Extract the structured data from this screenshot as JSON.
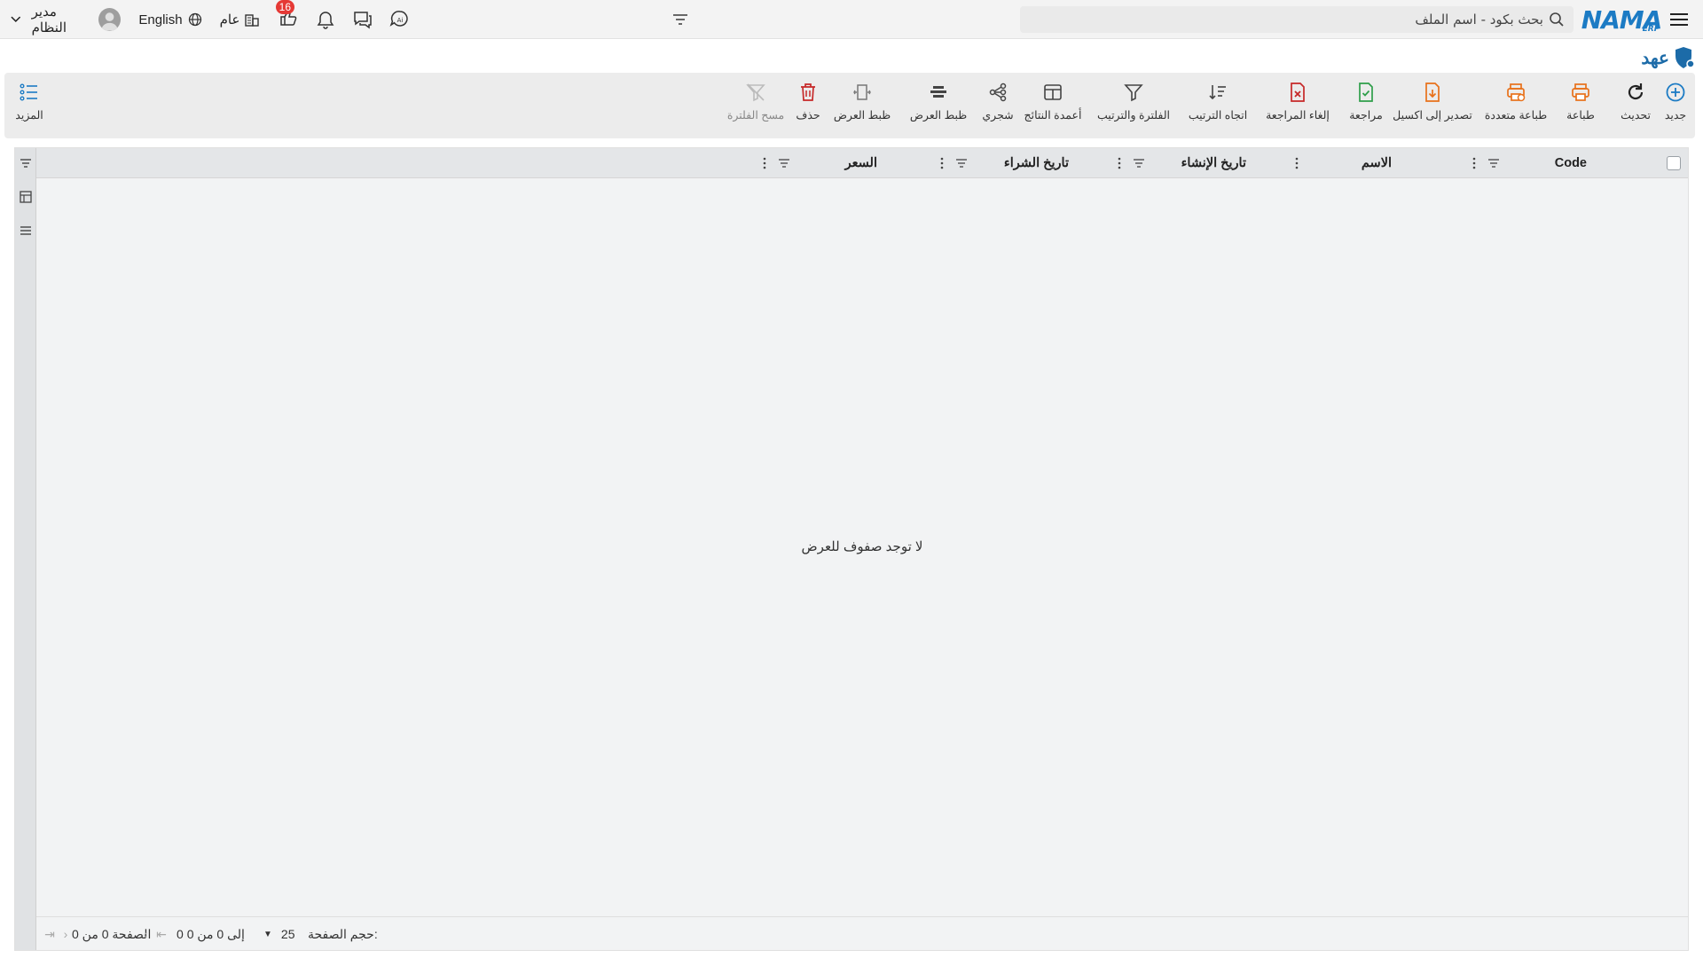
{
  "header": {
    "logo_text": "NAMA",
    "logo_sub": "ERP",
    "search_placeholder": "بحث بكود - اسم الملف",
    "notification_count": "16",
    "scope_label": "عام",
    "language_label": "English",
    "user_name": "مدير النظام"
  },
  "page": {
    "title": "عهد"
  },
  "toolbar": {
    "new": "جديد",
    "refresh": "تحديث",
    "print": "طباعة",
    "multi_print": "طباعة متعددة",
    "export_excel": "تصدير إلى اكسيل",
    "review": "مراجعة",
    "cancel_review": "إلغاء المراجعة",
    "sort_direction": "اتجاه الترتيب",
    "filter_sort": "الفلترة والترتيب",
    "result_columns": "أعمدة النتائج",
    "tree": "شجري",
    "fit_width_1": "ظبط العرض",
    "fit_width_2": "ظبط العرض",
    "delete": "حذف",
    "clear_filter": "مسح الفلترة",
    "more": "المزيد"
  },
  "grid": {
    "columns": [
      "Code",
      "الاسم",
      "تاريخ الإنشاء",
      "تاريخ الشراء",
      "السعر"
    ],
    "empty_message": "لا توجد صفوف للعرض",
    "footer": {
      "page_size_label": "حجم الصفحة:",
      "page_size_value": "25",
      "range_text": "0 إلى 0 من 0",
      "page_text": "الصفحة 0 من 0"
    }
  },
  "colors": {
    "brand_blue": "#1c7bc4",
    "orange": "#e8711a",
    "green": "#2e9e4a",
    "red": "#c62828"
  }
}
